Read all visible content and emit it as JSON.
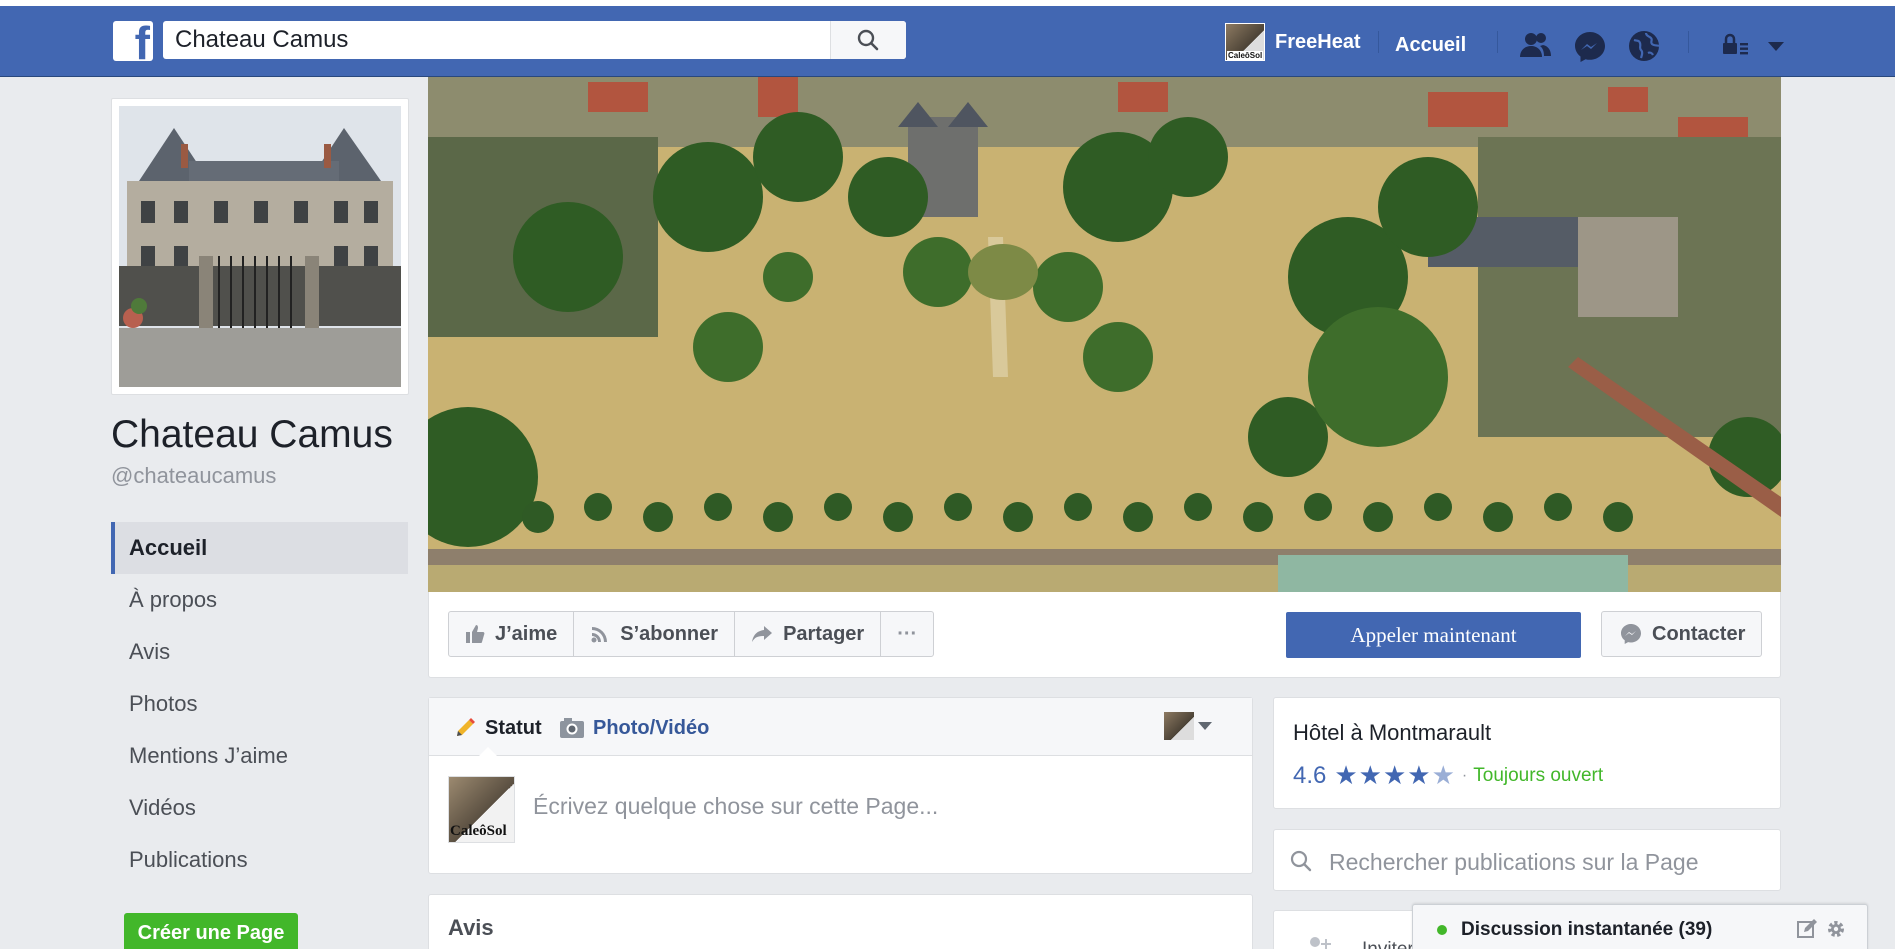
{
  "header": {
    "search_value": "Chateau Camus",
    "profile_name": "FreeHeat",
    "profile_badge": "CaleôSol",
    "home_label": "Accueil",
    "brand_color": "#4267b2"
  },
  "page": {
    "title": "Chateau Camus",
    "handle": "@chateaucamus"
  },
  "sidebar": {
    "items": [
      {
        "label": "Accueil",
        "active": true
      },
      {
        "label": "À propos"
      },
      {
        "label": "Avis"
      },
      {
        "label": "Photos"
      },
      {
        "label": "Mentions J’aime"
      },
      {
        "label": "Vidéos"
      },
      {
        "label": "Publications"
      }
    ],
    "create_page_label": "Créer une Page"
  },
  "actions": {
    "like": "J’aime",
    "follow": "S’abonner",
    "share": "Partager",
    "more": "···",
    "call": "Appeler maintenant",
    "contact": "Contacter"
  },
  "composer": {
    "tab_status": "Statut",
    "tab_photo": "Photo/Vidéo",
    "avatar_badge": "CaleôSol",
    "placeholder": "Écrivez quelque chose sur cette Page..."
  },
  "reviews": {
    "heading": "Avis"
  },
  "info": {
    "category": "Hôtel à Montmarault",
    "rating": "4.6",
    "stars_full": "★★★★",
    "stars_partial": "★",
    "separator": "·",
    "status": "Toujours ouvert"
  },
  "post_search": {
    "placeholder": "Rechercher publications sur la Page"
  },
  "invite": {
    "label": "Inviter"
  },
  "chat": {
    "label": "Discussion instantanée (39)"
  }
}
